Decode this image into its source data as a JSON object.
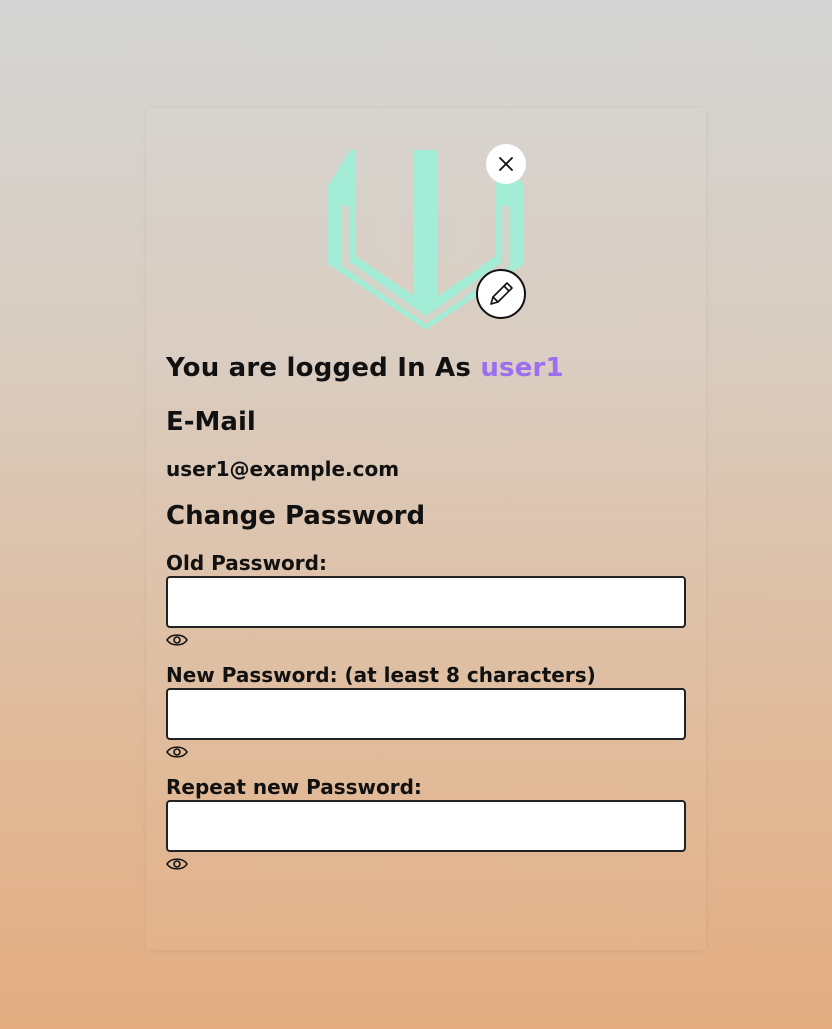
{
  "profile": {
    "logged_in_prefix": "You are logged In As",
    "username": "user1",
    "email_heading": "E-Mail",
    "email_value": "user1@example.com"
  },
  "password": {
    "heading": "Change Password",
    "fields": [
      {
        "label": "Old Password:",
        "value": ""
      },
      {
        "label": "New Password: (at least 8 characters)",
        "value": ""
      },
      {
        "label": "Repeat new Password:",
        "value": ""
      }
    ]
  },
  "icons": {
    "logo": "shield-logo-icon",
    "close": "close-icon",
    "edit": "pencil-icon",
    "visibility": "eye-icon"
  },
  "colors": {
    "logo": "#a3ecd6",
    "username": "#9c6ef0"
  }
}
